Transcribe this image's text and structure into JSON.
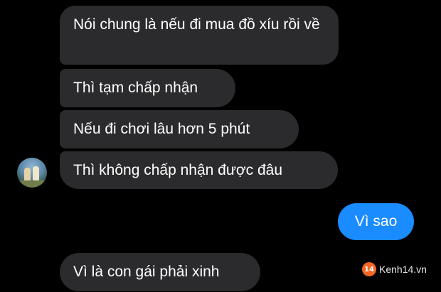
{
  "messages": [
    {
      "text": "Nói chung là nếu đi mua đồ xíu rồi về",
      "from": "other"
    },
    {
      "text": "Thì tạm chấp nhận",
      "from": "other"
    },
    {
      "text": "Nếu đi chơi lâu hơn 5 phút",
      "from": "other"
    },
    {
      "text": "Thì không chấp nhận được đâu",
      "from": "other"
    },
    {
      "text": "Vì sao",
      "from": "me"
    },
    {
      "text": "Vì là con gái phải xinh",
      "from": "other"
    }
  ],
  "watermark": {
    "logo": "14",
    "text": "Kenh14.vn"
  },
  "colors": {
    "received_bubble": "#2b2b2d",
    "sent_bubble": "#1a8cff",
    "background": "#000000",
    "logo": "#f26522"
  }
}
